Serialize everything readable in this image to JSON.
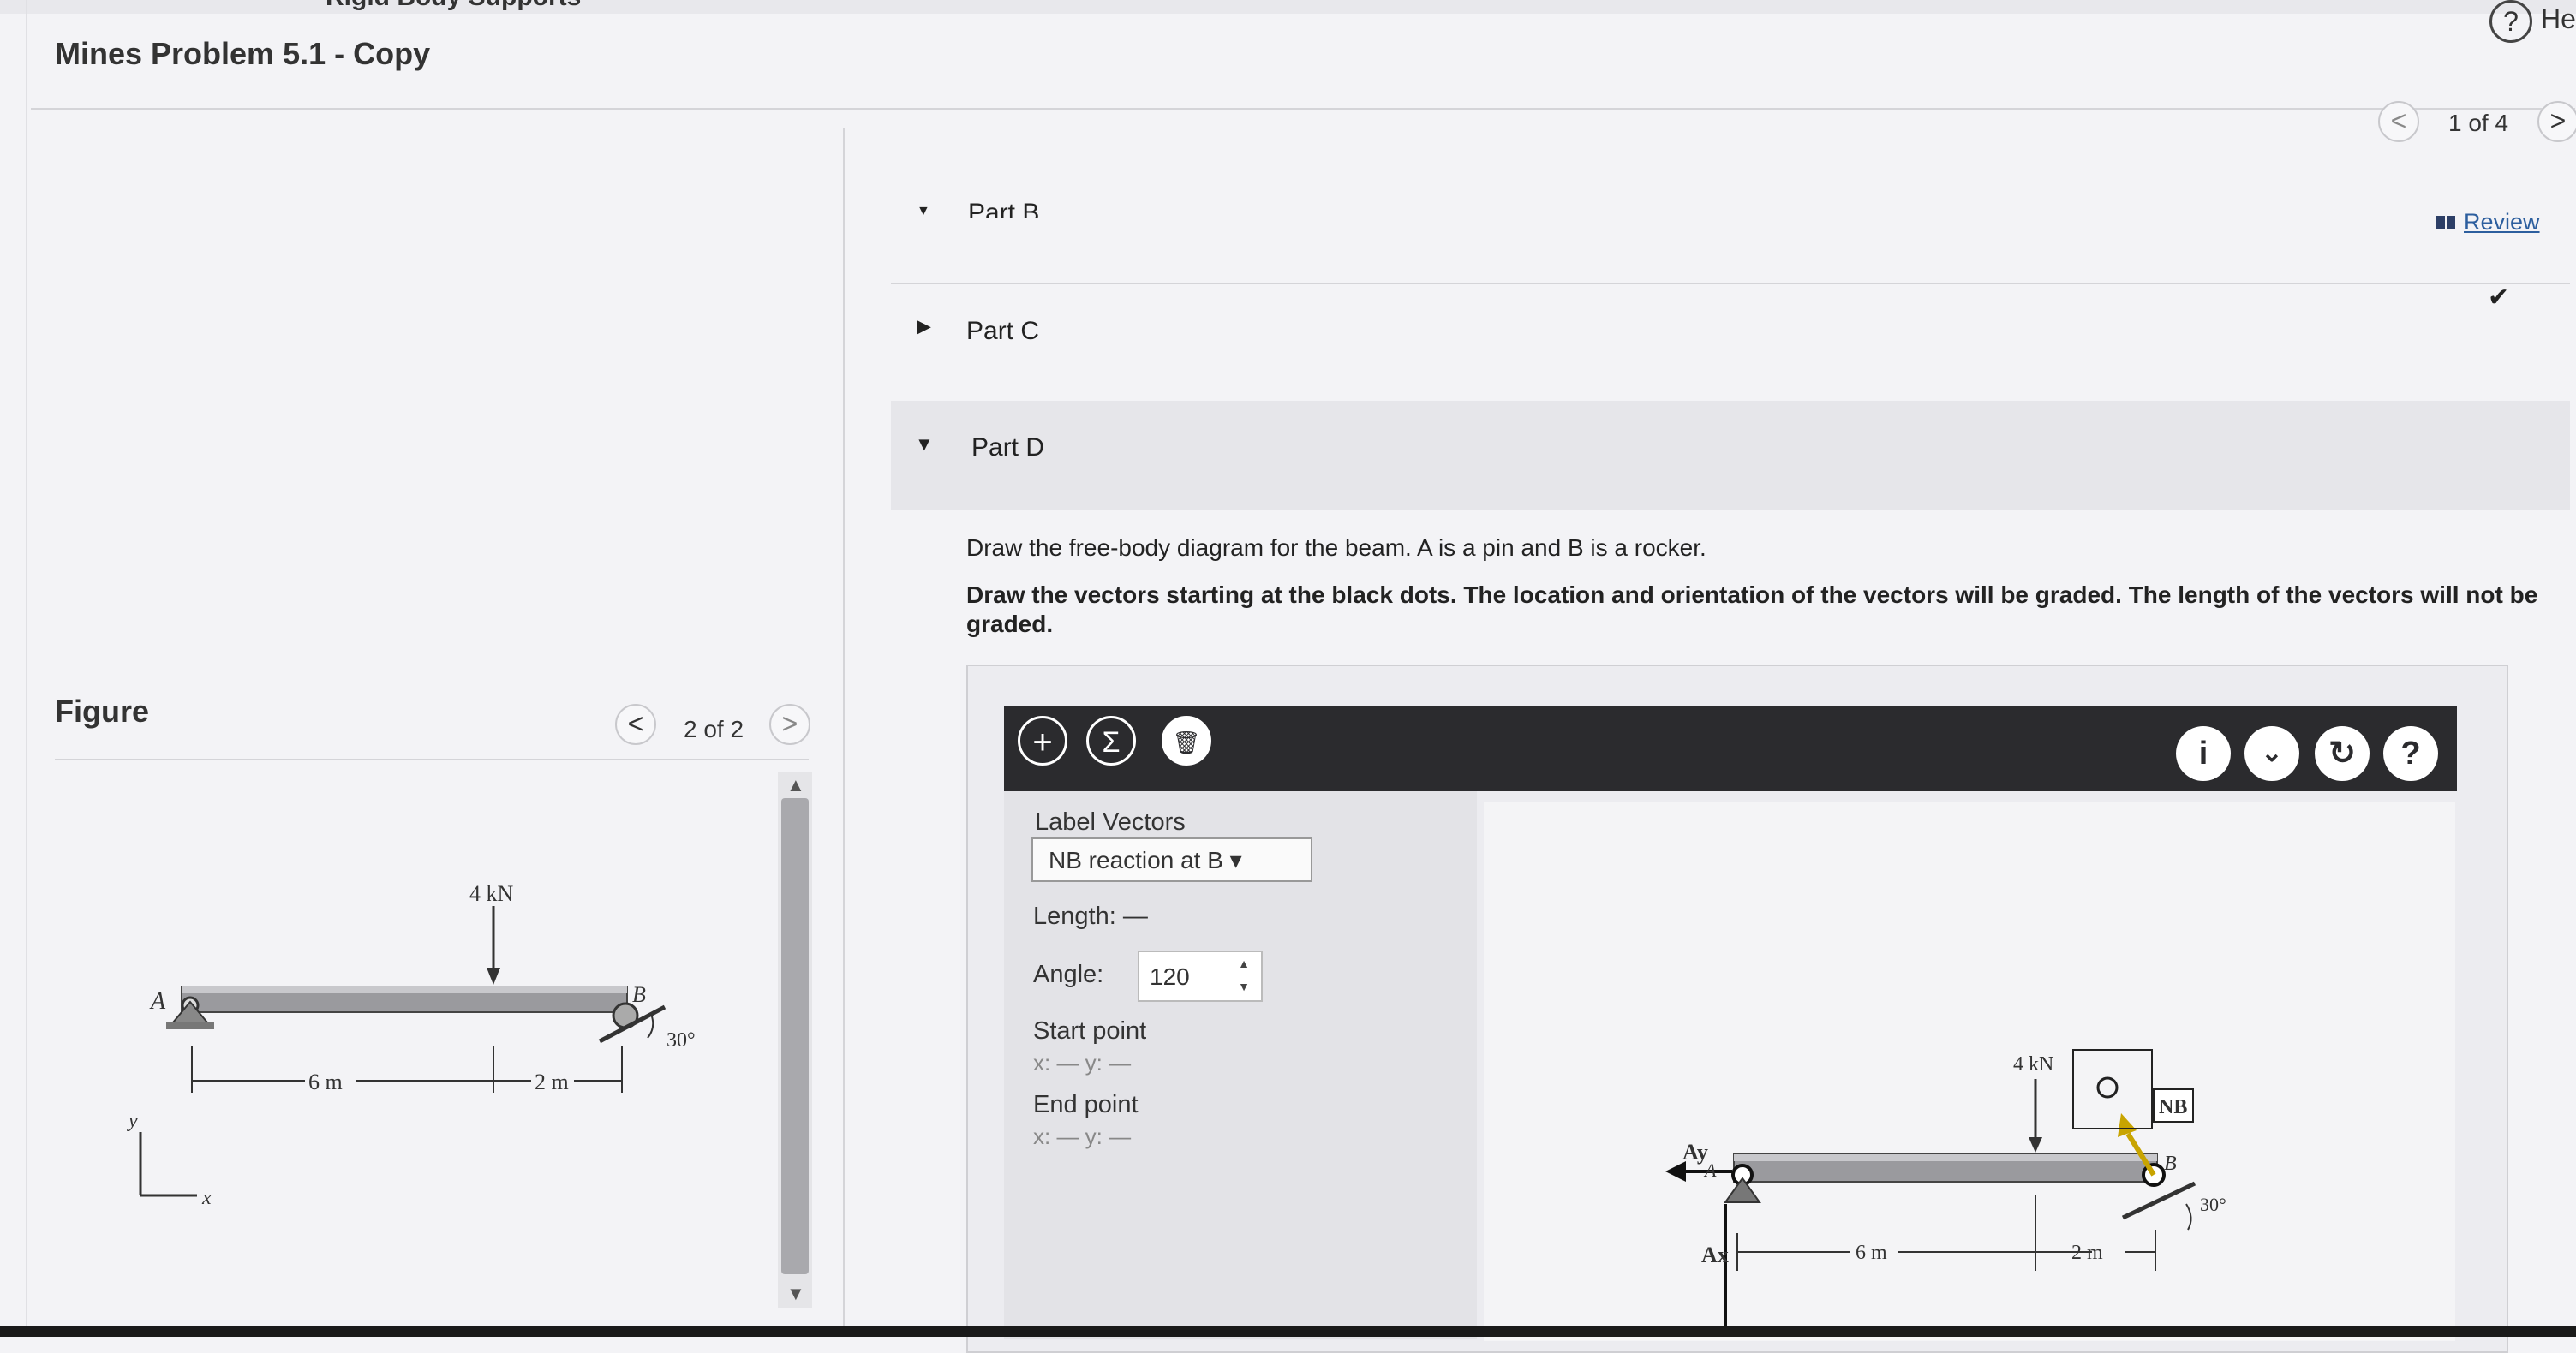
{
  "app": {
    "title": "Mines Problem 5.1 - Copy",
    "top_strip_text": "Rigid Body Supports",
    "help_label": "He"
  },
  "pager": {
    "text": "1 of 4",
    "prev": "<",
    "next": ">"
  },
  "review": {
    "label": "Review"
  },
  "parts": {
    "part_b": "Part B",
    "part_c": "Part C",
    "part_d": "Part D"
  },
  "instructions": {
    "line1": "Draw the free-body diagram for the beam. A is a pin and B is a rocker.",
    "line2": "Draw the vectors starting at the black dots. The location and orientation of the vectors will be graded. The length of the vectors will not be graded."
  },
  "figure": {
    "label": "Figure",
    "pager": "2 of 2",
    "load": "4 kN",
    "dim1": "6 m",
    "dim2": "2 m",
    "angle": "30°",
    "point_a": "A",
    "point_b": "B",
    "axis_x": "x",
    "axis_y": "y"
  },
  "tool": {
    "label_vectors": "Label Vectors",
    "selected_vector": "NB reaction at B",
    "length_label": "Length: —",
    "angle_label": "Angle:",
    "angle_value": "120",
    "start_point": "Start point",
    "start_coords": "x: — y: —",
    "end_point": "End point",
    "end_coords": "x: — y: —"
  },
  "canvas": {
    "load": "4 kN",
    "nb": "NB",
    "ay": "Ay",
    "ax": "Ax",
    "point_a": "A",
    "point_b": "B",
    "dim1": "6 m",
    "dim2": "2 m",
    "angle": "30°"
  },
  "colors": {
    "toolbar": "#2b2b2e",
    "link": "#2c5e9e",
    "vector": "#c8a400"
  }
}
